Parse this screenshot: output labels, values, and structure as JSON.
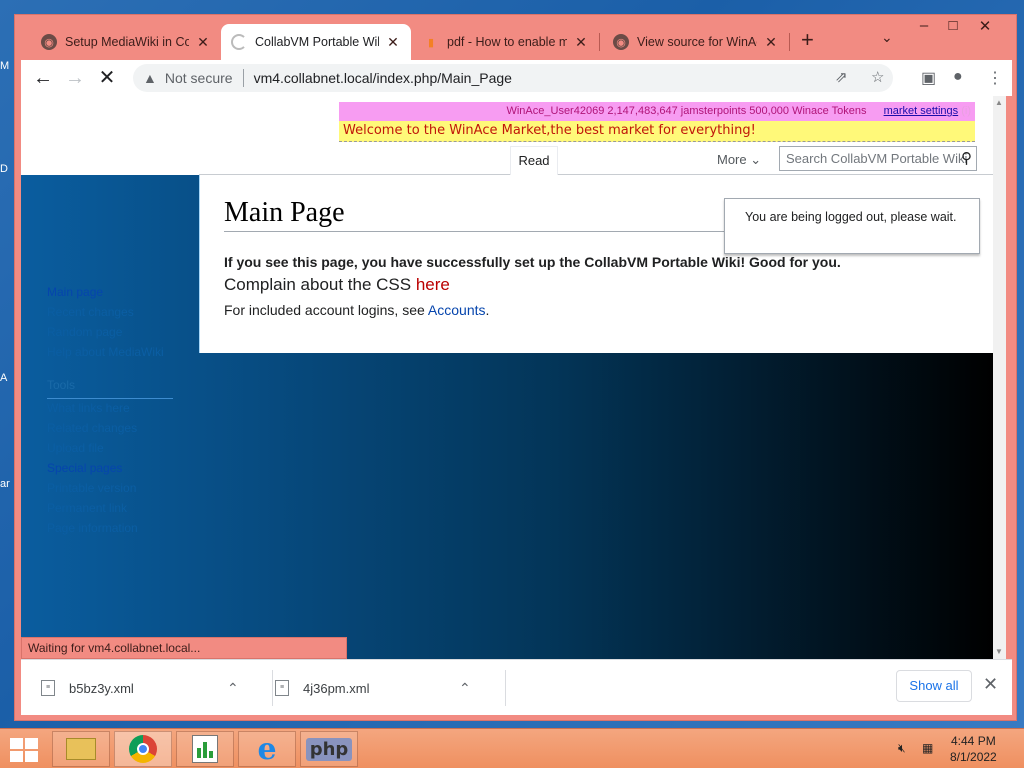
{
  "desktop": {
    "edge_labels": [
      "M",
      "D",
      "A",
      "ar"
    ]
  },
  "browser": {
    "tabs": [
      {
        "title": "Setup MediaWiki in Coll",
        "active": false
      },
      {
        "title": "CollabVM Portable Wiki",
        "active": true
      },
      {
        "title": "pdf - How to enable ml",
        "active": false
      },
      {
        "title": "View source for WinAce",
        "active": false
      }
    ],
    "new_tab_symbol": "+",
    "omnibox": {
      "security": "Not secure",
      "url": "vm4.collabnet.local/index.php/Main_Page"
    },
    "status_text": "Waiting for vm4.collabnet.local...",
    "window_controls": {
      "minimize": "–",
      "maximize": "□",
      "close": "✕"
    }
  },
  "market": {
    "user": "WinAce_User42069",
    "jamsterpoints": "2,147,483,647 jamsterpoints",
    "tokens": "500,000 Winace Tokens",
    "settings_link": "market settings",
    "settings_suffix": "(i)",
    "welcome": "Welcome to the WinAce Market,the best market for everything!"
  },
  "wiki": {
    "tabs": {
      "read": "Read",
      "more": "More"
    },
    "search_placeholder": "Search CollabVM Portable Wiki",
    "title": "Main Page",
    "intro_bold": "If you see this page, you have successfully set up the CollabVM Portable Wiki! Good for you.",
    "complain_text": "Complain about the CSS ",
    "complain_link": "here",
    "accounts_text": "For included account logins, see ",
    "accounts_link": "Accounts",
    "accounts_suffix": ".",
    "notification": "You are being logged out, please wait.",
    "sidebar": {
      "nav": [
        "Main page",
        "Recent changes",
        "Random page",
        "Help about MediaWiki"
      ],
      "tools_header": "Tools",
      "tools": [
        "What links here",
        "Related changes",
        "Upload file",
        "Special pages",
        "Printable version",
        "Permanent link",
        "Page information"
      ]
    }
  },
  "downloads": {
    "items": [
      {
        "name": "b5bz3y.xml"
      },
      {
        "name": "4j36pm.xml"
      }
    ],
    "show_all": "Show all"
  },
  "taskbar": {
    "apps": [
      "file-explorer",
      "chrome",
      "notepad-chart",
      "internet-explorer",
      "php"
    ],
    "php_label": "php",
    "time": "4:44 PM",
    "date": "8/1/2022"
  },
  "colors": {
    "browser_frame": "#f28b82",
    "taskbar": "#ef9060",
    "market_top": "#f79cf2",
    "market_welcome": "#fff979",
    "link": "#0645ad",
    "redlink": "#ba0000"
  }
}
